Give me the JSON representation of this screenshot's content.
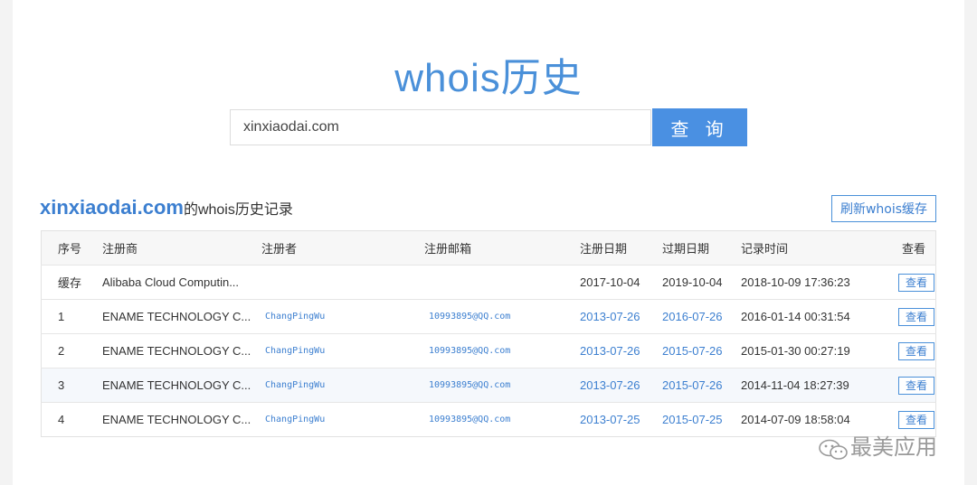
{
  "hero": {
    "title": "whois历史"
  },
  "search": {
    "value": "xinxiaodai.com",
    "button_label": "查 询"
  },
  "section": {
    "domain": "xinxiaodai.com",
    "suffix": "的whois历史记录",
    "refresh_label": "刷新whois缓存"
  },
  "table": {
    "headers": [
      "序号",
      "注册商",
      "注册者",
      "注册邮箱",
      "注册日期",
      "过期日期",
      "记录时间",
      "查看"
    ],
    "rows": [
      {
        "no": "缓存",
        "registrar": "Alibaba Cloud Computin...",
        "registrant": "",
        "email": "",
        "reg_date": "2017-10-04",
        "exp_date": "2019-10-04",
        "record_time": "2018-10-09 17:36:23",
        "view": "查看"
      },
      {
        "no": "1",
        "registrar": "ENAME TECHNOLOGY C...",
        "registrant": "ChangPingWu",
        "email": "10993895@QQ.com",
        "reg_date": "2013-07-26",
        "exp_date": "2016-07-26",
        "record_time": "2016-01-14 00:31:54",
        "view": "查看"
      },
      {
        "no": "2",
        "registrar": "ENAME TECHNOLOGY C...",
        "registrant": "ChangPingWu",
        "email": "10993895@QQ.com",
        "reg_date": "2013-07-26",
        "exp_date": "2015-07-26",
        "record_time": "2015-01-30 00:27:19",
        "view": "查看"
      },
      {
        "no": "3",
        "registrar": "ENAME TECHNOLOGY C...",
        "registrant": "ChangPingWu",
        "email": "10993895@QQ.com",
        "reg_date": "2013-07-26",
        "exp_date": "2015-07-26",
        "record_time": "2014-11-04 18:27:39",
        "view": "查看"
      },
      {
        "no": "4",
        "registrar": "ENAME TECHNOLOGY C...",
        "registrant": "ChangPingWu",
        "email": "10993895@QQ.com",
        "reg_date": "2013-07-25",
        "exp_date": "2015-07-25",
        "record_time": "2014-07-09 18:58:04",
        "view": "查看"
      }
    ]
  },
  "watermark": {
    "text": "最美应用",
    "icon": "wechat-icon"
  },
  "colors": {
    "accent": "#4a90e2",
    "link": "#3c7fd0",
    "title": "#4a90d9"
  }
}
